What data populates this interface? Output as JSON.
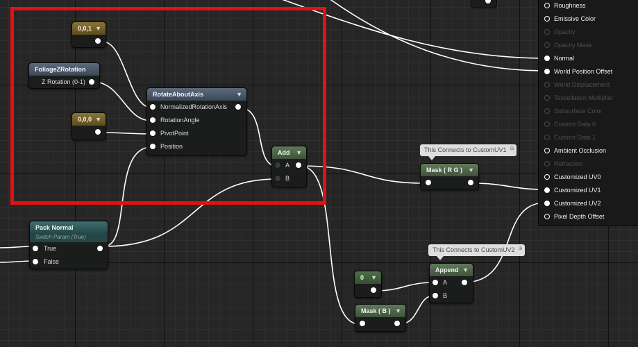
{
  "nodes": {
    "const_top": {
      "title": "0,0,1"
    },
    "foliage": {
      "title": "FoliageZRotation",
      "output_label": "Z Rotation (0-1)"
    },
    "const_mid": {
      "title": "0,0,0"
    },
    "rotate": {
      "title": "RotateAboutAxis",
      "inputs": [
        "NormalizedRotationAxis",
        "RotationAngle",
        "PivotPoint",
        "Position"
      ]
    },
    "add": {
      "title": "Add",
      "inputs": [
        "A",
        "B"
      ]
    },
    "pack_normal": {
      "title": "Pack Normal",
      "subtitle": "Switch Param (True)",
      "inputs": [
        "True",
        "False"
      ]
    },
    "mask_rg": {
      "title": "Mask ( R G )"
    },
    "const_zero": {
      "title": "0"
    },
    "append": {
      "title": "Append",
      "inputs": [
        "A",
        "B"
      ]
    },
    "mask_b": {
      "title": "Mask ( B )"
    }
  },
  "comments": {
    "uv1": "This Connects to CustomUV1",
    "uv2": "This Connects to CustomUV2"
  },
  "result_pins": [
    {
      "label": "Roughness",
      "state": "on"
    },
    {
      "label": "Emissive Color",
      "state": "on"
    },
    {
      "label": "Opacity",
      "state": "off"
    },
    {
      "label": "Opacity Mask",
      "state": "off"
    },
    {
      "label": "Normal",
      "state": "connected"
    },
    {
      "label": "World Position Offset",
      "state": "connected"
    },
    {
      "label": "World Displacement",
      "state": "off"
    },
    {
      "label": "Tessellation Multiplier",
      "state": "off"
    },
    {
      "label": "Subsurface Color",
      "state": "off"
    },
    {
      "label": "Custom Data 0",
      "state": "off"
    },
    {
      "label": "Custom Data 1",
      "state": "off"
    },
    {
      "label": "Ambient Occlusion",
      "state": "on"
    },
    {
      "label": "Refraction",
      "state": "off"
    },
    {
      "label": "Customized UV0",
      "state": "on"
    },
    {
      "label": "Customized UV1",
      "state": "connected"
    },
    {
      "label": "Customized UV2",
      "state": "connected"
    },
    {
      "label": "Pixel Depth Offset",
      "state": "on"
    }
  ],
  "colors": {
    "highlight": "#e31212",
    "wire": "#ffffff",
    "constant_header": "#7a6628",
    "parameter_header": "#4e5d6d",
    "math_header": "#55704f",
    "switch_header": "#2f5a5b"
  },
  "icons": {
    "dropdown": "chevron-down-icon",
    "pin_connected": "filled-circle",
    "pin_unconnected": "hollow-circle",
    "comment_pin": "pin-icon"
  }
}
